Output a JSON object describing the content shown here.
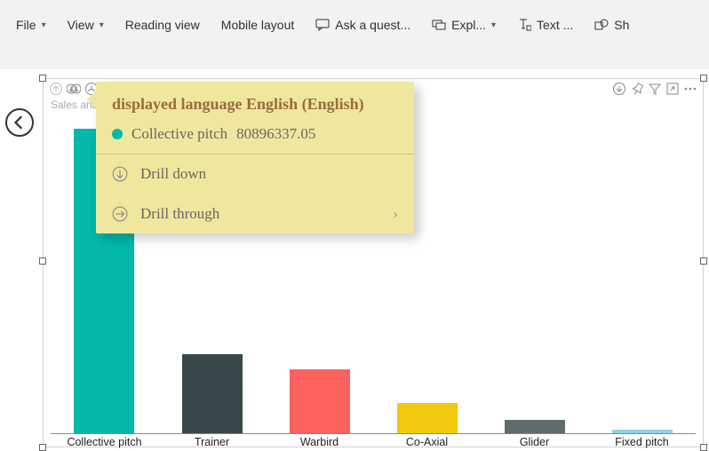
{
  "toolbar": {
    "file": "File",
    "view": "View",
    "reading_view": "Reading view",
    "mobile_layout": "Mobile layout",
    "ask": "Ask a quest...",
    "explore": "Expl...",
    "text": "Text ...",
    "share": "Sh"
  },
  "visual": {
    "title": "Sales and Quantity by Category"
  },
  "chart_data": {
    "type": "bar",
    "title": "Sales and Quantity by Category",
    "xlabel": "",
    "ylabel": "",
    "categories": [
      "Collective pitch",
      "Trainer",
      "Warbird",
      "Co-Axial",
      "Glider",
      "Fixed pitch"
    ],
    "values": [
      80896337.05,
      21000000,
      17000000,
      8000000,
      3500000,
      1000000
    ],
    "colors": [
      "#01b8aa",
      "#374649",
      "#fd625e",
      "#f2c80f",
      "#5f6b6d",
      "#8ad4eb"
    ],
    "ylim": [
      0,
      85000000
    ]
  },
  "tooltip": {
    "title": "displayed language English (English)",
    "series_label": "Collective pitch",
    "series_value": "80896337.05",
    "dot_color": "#01b8aa",
    "drill_down": "Drill down",
    "drill_through": "Drill through"
  }
}
